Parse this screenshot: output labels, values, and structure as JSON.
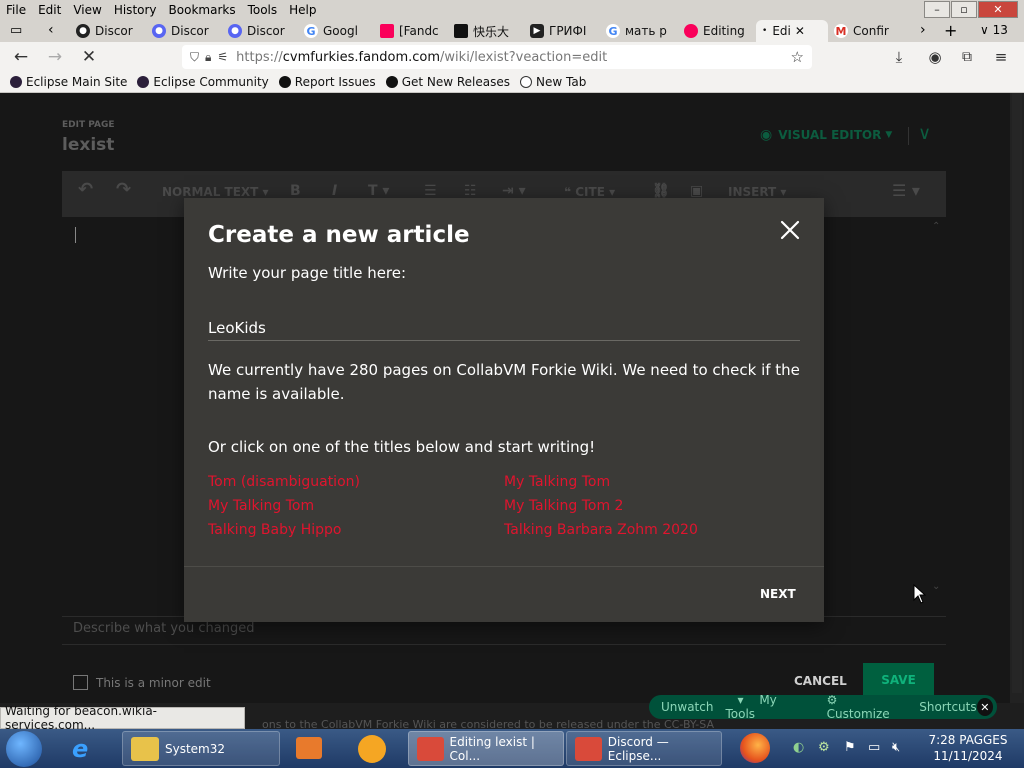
{
  "menubar": {
    "items": [
      {
        "label": "File"
      },
      {
        "label": "Edit"
      },
      {
        "label": "View"
      },
      {
        "label": "History"
      },
      {
        "label": "Bookmarks"
      },
      {
        "label": "Tools"
      },
      {
        "label": "Help"
      }
    ]
  },
  "tabs": [
    {
      "label": "Discor"
    },
    {
      "label": "Discor"
    },
    {
      "label": "Discor"
    },
    {
      "label": "Googl"
    },
    {
      "label": "[Fandc"
    },
    {
      "label": "快乐大"
    },
    {
      "label": "ГРИФІ"
    },
    {
      "label": "мать р"
    },
    {
      "label": "Editing"
    },
    {
      "label": "Edi"
    },
    {
      "label": "Confir"
    }
  ],
  "tab_count": "13",
  "address": {
    "prefix": "https://",
    "host": "cvmfurkies.fandom.com",
    "path": "/wiki/lexist?veaction=edit"
  },
  "bookmarks": [
    {
      "label": "Eclipse Main Site"
    },
    {
      "label": "Eclipse Community"
    },
    {
      "label": "Report Issues"
    },
    {
      "label": "Get New Releases"
    },
    {
      "label": "New Tab"
    }
  ],
  "editor": {
    "edit_page_label": "EDIT PAGE",
    "page_name": "lexist",
    "visual_editor_label": "VISUAL EDITOR",
    "toolbar": {
      "normal_text": "NORMAL TEXT",
      "cite": "CITE",
      "insert": "INSERT"
    },
    "summary_placeholder": "Describe what you changed",
    "minor_edit_label": "This is a minor edit",
    "cancel_label": "CANCEL",
    "save_label": "SAVE",
    "footer_text": "ons to the CollabVM Forkie Wiki are considered to be released under the CC-BY-SA"
  },
  "modal": {
    "title": "Create a new article",
    "prompt": "Write your page title here:",
    "input_value": "LeoKids",
    "info": "We currently have 280 pages on CollabVM Forkie Wiki. We need to check if the name is available.",
    "or_text": "Or click on one of the titles below and start writing!",
    "suggestions": [
      "Tom (disambiguation)",
      "My Talking Tom",
      "My Talking Tom",
      "My Talking Tom 2",
      "Talking Baby Hippo",
      "Talking Barbara Zohm 2020"
    ],
    "next_label": "NEXT"
  },
  "tools": {
    "unwatch": "Unwatch",
    "my_tools": "My Tools",
    "customize": "Customize",
    "shortcuts": "Shortcuts"
  },
  "status": "Waiting for beacon.wikia-services.com...",
  "taskbar": {
    "items": [
      {
        "label": "System32"
      },
      {
        "label": "Editing lexist | Col..."
      },
      {
        "label": "Discord — Eclipse..."
      }
    ],
    "time": "7:28 PAGGES",
    "date": "11/11/2024"
  }
}
